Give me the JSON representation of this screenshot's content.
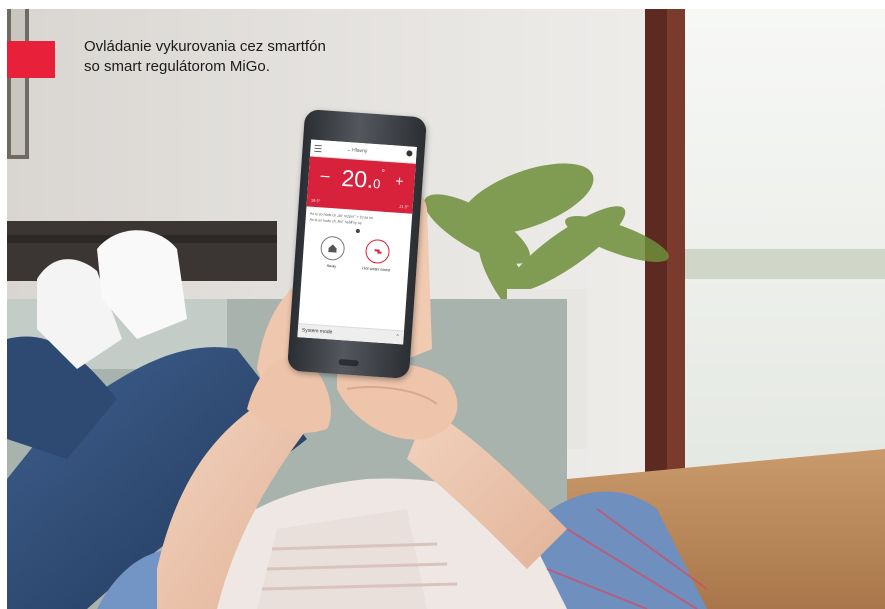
{
  "caption": {
    "line1": "Ovládanie vykurovania cez smartfón",
    "line2": "so smart regulátorom MiGo."
  },
  "colors": {
    "accent_red": "#e8203a",
    "app_red": "#d8213b"
  },
  "phone_app": {
    "zone_label": "Hlavný",
    "temperature": "20.",
    "temperature_decimal": "0",
    "degree_symbol": "°",
    "minus": "–",
    "plus": "+",
    "current_temp": "19.5°",
    "outdoor_temp": "21.5°",
    "schedule_line1": "As is so hods ch „do' rozpor\" > 10 as us",
    "schedule_line2": "As is so hods ch „Ro\" nebll'ny us",
    "mode_away": "Away",
    "mode_hot_water": "Hot water boost",
    "system_mode": "System mode",
    "icons": [
      "menu-icon",
      "help-icon",
      "home-icon",
      "tap-icon",
      "chevron-up-icon"
    ]
  }
}
